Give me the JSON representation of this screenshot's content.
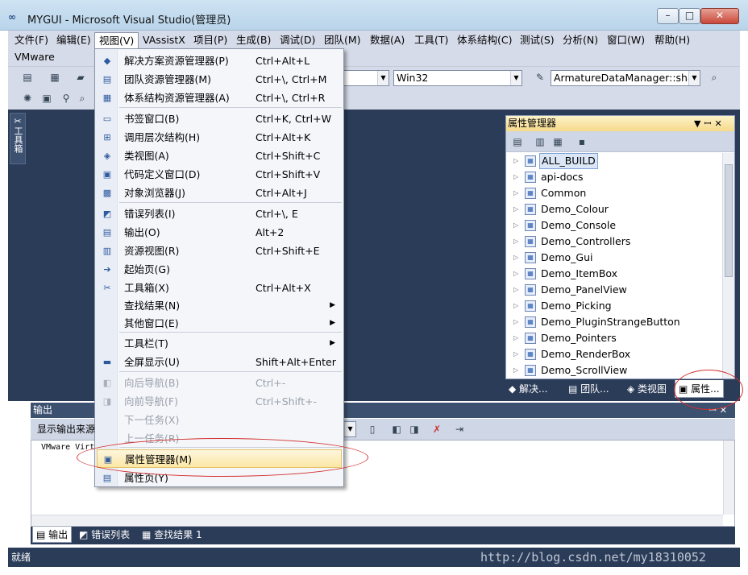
{
  "window": {
    "title": "MYGUI - Microsoft Visual Studio(管理员)"
  },
  "menubar": {
    "row1": [
      "文件(F)",
      "编辑(E)",
      "视图(V)",
      "VAssistX",
      "项目(P)",
      "生成(B)",
      "调试(D)",
      "团队(M)",
      "数据(A)",
      "工具(T)",
      "体系结构(C)",
      "测试(S)",
      "分析(N)",
      "窗口(W)",
      "帮助(H)"
    ],
    "row2": [
      "VMware"
    ]
  },
  "toolbar": {
    "config_value": "g",
    "platform_value": "Win32",
    "find_value": "ArmatureDataManager::share"
  },
  "toolbox": {
    "label": "工具箱"
  },
  "view_menu": {
    "items": [
      {
        "icon": "solution-explorer-icon",
        "label": "解决方案资源管理器(P)",
        "shortcut": "Ctrl+Alt+L",
        "enabled": true
      },
      {
        "icon": "team-explorer-icon",
        "label": "团队资源管理器(M)",
        "shortcut": "Ctrl+\\, Ctrl+M",
        "enabled": true
      },
      {
        "icon": "architecture-explorer-icon",
        "label": "体系结构资源管理器(A)",
        "shortcut": "Ctrl+\\, Ctrl+R",
        "enabled": true
      },
      {
        "icon": "bookmark-icon",
        "label": "书签窗口(B)",
        "shortcut": "Ctrl+K, Ctrl+W",
        "enabled": true
      },
      {
        "icon": "call-hierarchy-icon",
        "label": "调用层次结构(H)",
        "shortcut": "Ctrl+Alt+K",
        "enabled": true
      },
      {
        "icon": "class-view-icon",
        "label": "类视图(A)",
        "shortcut": "Ctrl+Shift+C",
        "enabled": true
      },
      {
        "icon": "code-definition-icon",
        "label": "代码定义窗口(D)",
        "shortcut": "Ctrl+Shift+V",
        "enabled": true
      },
      {
        "icon": "object-browser-icon",
        "label": "对象浏览器(J)",
        "shortcut": "Ctrl+Alt+J",
        "enabled": true
      },
      {
        "icon": "error-list-icon",
        "label": "错误列表(I)",
        "shortcut": "Ctrl+\\, E",
        "enabled": true
      },
      {
        "icon": "output-icon",
        "label": "输出(O)",
        "shortcut": "Alt+2",
        "enabled": true
      },
      {
        "icon": "resource-view-icon",
        "label": "资源视图(R)",
        "shortcut": "Ctrl+Shift+E",
        "enabled": true
      },
      {
        "icon": "start-page-icon",
        "label": "起始页(G)",
        "shortcut": "",
        "enabled": true
      },
      {
        "icon": "toolbox-icon",
        "label": "工具箱(X)",
        "shortcut": "Ctrl+Alt+X",
        "enabled": true
      },
      {
        "icon": "",
        "label": "查找结果(N)",
        "shortcut": "",
        "enabled": true,
        "submenu": true
      },
      {
        "icon": "",
        "label": "其他窗口(E)",
        "shortcut": "",
        "enabled": true,
        "submenu": true
      },
      {
        "icon": "",
        "label": "工具栏(T)",
        "shortcut": "",
        "enabled": true,
        "submenu": true
      },
      {
        "icon": "full-screen-icon",
        "label": "全屏显示(U)",
        "shortcut": "Shift+Alt+Enter",
        "enabled": true
      },
      {
        "icon": "navigate-back-icon",
        "label": "向后导航(B)",
        "shortcut": "Ctrl+-",
        "enabled": false
      },
      {
        "icon": "navigate-forward-icon",
        "label": "向前导航(F)",
        "shortcut": "Ctrl+Shift+-",
        "enabled": false
      },
      {
        "icon": "",
        "label": "下一任务(X)",
        "shortcut": "",
        "enabled": false
      },
      {
        "icon": "",
        "label": "上一任务(R)",
        "shortcut": "",
        "enabled": false
      },
      {
        "icon": "property-manager-icon",
        "label": "属性管理器(M)",
        "shortcut": "",
        "enabled": true,
        "highlighted": true
      },
      {
        "icon": "property-pages-icon",
        "label": "属性页(Y)",
        "shortcut": "",
        "enabled": true
      }
    ]
  },
  "property_manager": {
    "title": "属性管理器",
    "projects": [
      "ALL_BUILD",
      "api-docs",
      "Common",
      "Demo_Colour",
      "Demo_Console",
      "Demo_Controllers",
      "Demo_Gui",
      "Demo_ItemBox",
      "Demo_PanelView",
      "Demo_Picking",
      "Demo_PluginStrangeButton",
      "Demo_Pointers",
      "Demo_RenderBox",
      "Demo_ScrollView"
    ],
    "selected": "ALL_BUILD",
    "tabs": [
      "解决...",
      "团队...",
      "类视图",
      "属性..."
    ]
  },
  "output": {
    "title": "输出",
    "source_label": "显示输出来源",
    "text": "VMware Virt",
    "tabs": [
      "输出",
      "错误列表",
      "查找结果 1"
    ]
  },
  "status": {
    "text": "就绪"
  },
  "watermark": "http://blog.csdn.net/my18310052",
  "colors": {
    "workspace": "#2b3c59",
    "highlight": "#fbe7a6",
    "annotation": "#d43030"
  }
}
